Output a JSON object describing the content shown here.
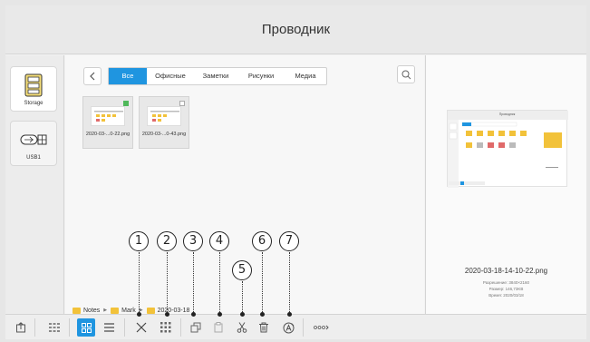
{
  "title": "Проводник",
  "sidebar": {
    "devices": [
      {
        "label": "Storage",
        "icon": "storage-icon"
      },
      {
        "label": "USB1",
        "icon": "usb-icon"
      }
    ]
  },
  "tabs": [
    {
      "label": "Все",
      "active": true
    },
    {
      "label": "Офисные",
      "active": false
    },
    {
      "label": "Заметки",
      "active": false
    },
    {
      "label": "Рисунки",
      "active": false
    },
    {
      "label": "Медиа",
      "active": false
    }
  ],
  "files": [
    {
      "name": "2020-03-...0-22.png",
      "selected": true
    },
    {
      "name": "2020-03-...0-43.png",
      "selected": false
    }
  ],
  "breadcrumb": [
    "Notes",
    "Mark",
    "2020-03-18"
  ],
  "preview": {
    "mini_title": "Проводник",
    "filename": "2020-03-18-14-10-22.png",
    "resolution": "Разрешение: 3840×2160",
    "size": "Размер: 146,73KB",
    "time": "Время: 2020/03/18"
  },
  "callouts": [
    "1",
    "2",
    "3",
    "4",
    "5",
    "6",
    "7"
  ],
  "colors": {
    "accent": "#1f95e0",
    "folder": "#f2c23a",
    "check": "#4fb85a"
  }
}
